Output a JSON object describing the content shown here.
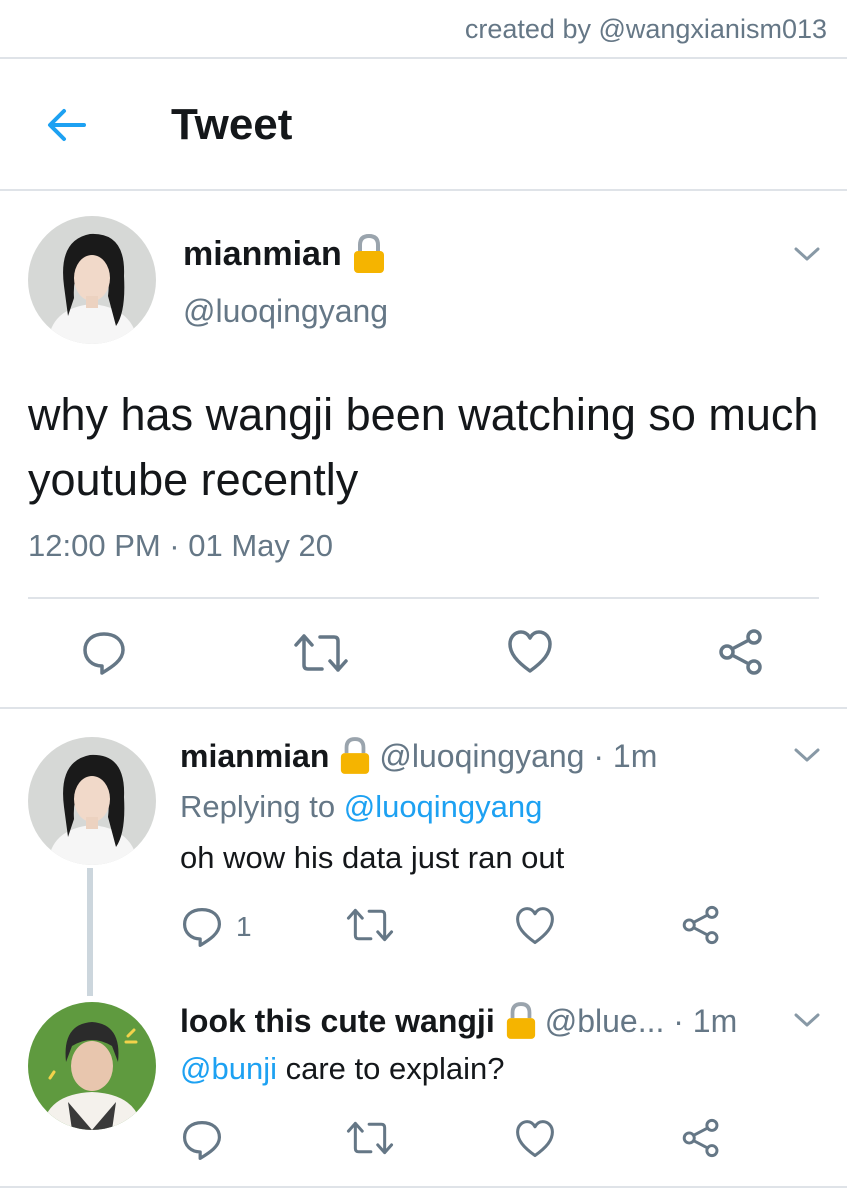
{
  "credit": "created by @wangxianism013",
  "header": {
    "title": "Tweet"
  },
  "main_tweet": {
    "name": "mianmian",
    "handle": "@luoqingyang",
    "text": "why has wangji been watching so much youtube recently",
    "timestamp": "12:00 PM · 01 May 20"
  },
  "replies": [
    {
      "name": "mianmian",
      "meta": "@luoqingyang · 1m",
      "replying_prefix": "Replying to ",
      "replying_handle": "@luoqingyang",
      "text": "oh wow his data just ran out",
      "reply_count": "1"
    },
    {
      "name": "look this cute wangji",
      "meta": "@blue... · 1m",
      "mention": "@bunji",
      "text": " care to explain?"
    }
  ],
  "icons": [
    "back-arrow-icon",
    "chevron-down-icon",
    "lock-icon",
    "reply-icon",
    "retweet-icon",
    "like-icon",
    "share-icon"
  ],
  "colors": {
    "accent": "#1da1f2",
    "muted": "#657786",
    "text": "#14171a",
    "divider": "#dfe3e8",
    "lock": "#f5b400"
  }
}
